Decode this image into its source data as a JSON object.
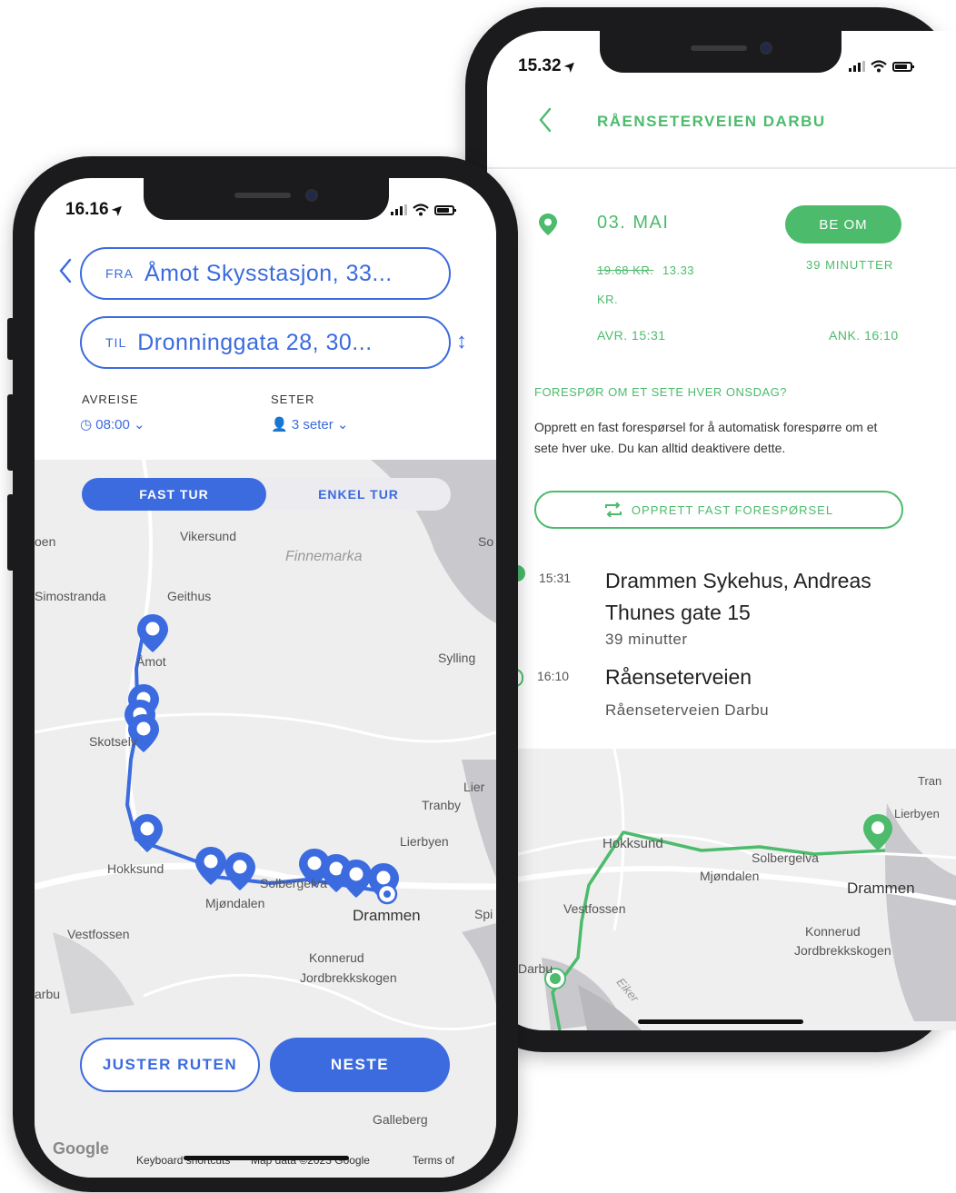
{
  "left": {
    "status": {
      "time": "16.16",
      "arrow": "➤"
    },
    "from": {
      "prefix": "FRA",
      "value": "Åmot Skysstasjon, 33..."
    },
    "to": {
      "prefix": "TIL",
      "value": "Dronninggata 28, 30..."
    },
    "swap_icon": "↕",
    "departure": {
      "label": "AVREISE",
      "value": "08:00"
    },
    "seats": {
      "label": "SETER",
      "value": "3 seter"
    },
    "tabs": [
      "FAST TUR",
      "ENKEL TUR"
    ],
    "map_labels": {
      "vikersund": "Vikersund",
      "finnemarka": "Finnemarka",
      "simostranda": "Simostranda",
      "geithus": "Geithus",
      "amot": "Åmot",
      "sylling": "Sylling",
      "skotselv": "Skotselv",
      "hokksund": "Hokksund",
      "mjondalen": "Mjøndalen",
      "solbergelva": "Solbergelva",
      "drammen": "Drammen",
      "tranby": "Tranby",
      "lierbyen": "Lierbyen",
      "lier": "Lier",
      "vestfossen": "Vestfossen",
      "konnerud": "Konnerud",
      "jordbrekkskogen": "Jordbrekkskogen",
      "galleberg": "Galleberg",
      "oen": "oen",
      "arbu": "arbu",
      "so": "So",
      "spi": "Spi"
    },
    "buttons": {
      "adjust": "JUSTER RUTEN",
      "next": "NESTE"
    },
    "footer": {
      "google": "Google",
      "keyboard": "Keyboard shortcuts",
      "mapdata": "Map data ©2023 Google",
      "terms": "Terms of"
    }
  },
  "right": {
    "status": {
      "time": "15.32",
      "arrow": "➤"
    },
    "title": "RÅENSETERVEIEN DARBU",
    "date": "03. MAI",
    "request_button": "BE OM",
    "duration_badge": "39 MINUTTER",
    "price_old": "19.68 KR.",
    "price_new": "13.33",
    "price_unit": "KR.",
    "depart": "AVR. 15:31",
    "arrive": "ANK. 16:10",
    "repeat_question": "FORESPØR OM ET SETE HVER ONSDAG?",
    "repeat_description": "Opprett en fast forespørsel for å automatisk forespørre om et sete hver uke. Du kan alltid deaktivere dette.",
    "repeat_button": "OPPRETT FAST FORESPØRSEL",
    "stops": [
      {
        "time": "15:31",
        "title": "Drammen Sykehus, Andreas Thunes gate 15",
        "subtitle": "39 minutter"
      },
      {
        "time": "16:10",
        "title": "Råenseterveien",
        "subtitle": "Råenseterveien Darbu"
      }
    ],
    "map_labels": {
      "hokksund": "Hokksund",
      "solbergelva": "Solbergelva",
      "mjondalen": "Mjøndalen",
      "drammen": "Drammen",
      "vestfossen": "Vestfossen",
      "konnerud": "Konnerud",
      "jordbrekkskogen": "Jordbrekkskogen",
      "darbu": "Darbu",
      "lierbyen": "Lierbyen",
      "tran": "Tran",
      "eiker": "Eiker"
    }
  },
  "colors": {
    "blue": "#3b6bdf",
    "green": "#4cbb6c",
    "frame": "#1b1b1d"
  }
}
